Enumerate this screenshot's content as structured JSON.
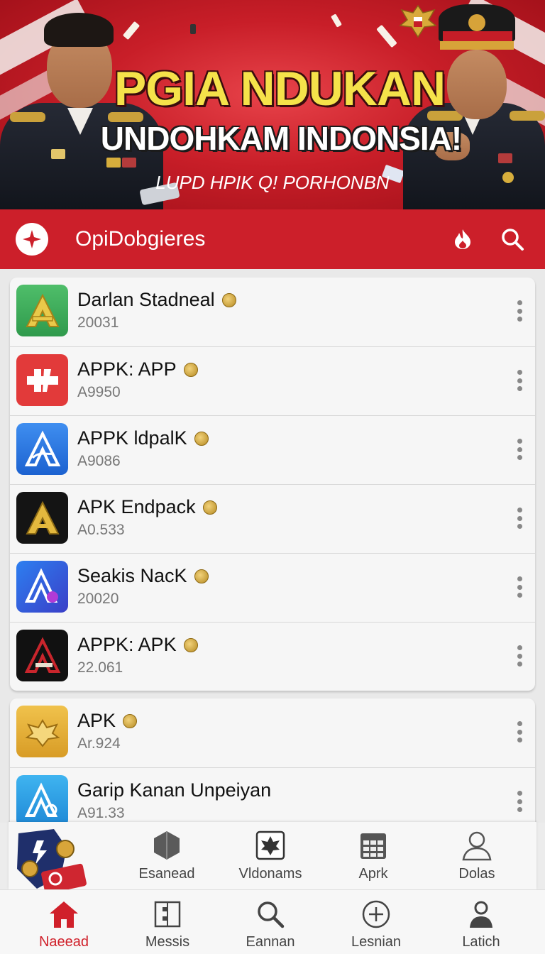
{
  "banner": {
    "title_line1": "PGIA NDUKAN",
    "title_line2": "UNDOHKAM INDONSIA!",
    "subtitle": "LUPD HPIK Q! PORHONBN"
  },
  "toolbar": {
    "title": "OpiDobgieres",
    "accent_color": "#cc1f2a"
  },
  "apps": [
    {
      "name": "Darlan Stadneal",
      "sub": "20031",
      "icon": "letter-a-green-icon"
    },
    {
      "name": "APPK: APP",
      "sub": "A9950",
      "icon": "pulse-red-icon"
    },
    {
      "name": "APPK ldpalK",
      "sub": "A9086",
      "icon": "letter-a-blue-icon"
    },
    {
      "name": "APK Endpack",
      "sub": "A0.533",
      "icon": "letter-a-gold-icon"
    },
    {
      "name": "Seakis NacK",
      "sub": "20020",
      "icon": "letter-a-blue-gradient-icon"
    },
    {
      "name": "APPK: APK",
      "sub": "22.061",
      "icon": "letter-a-red-dark-icon"
    },
    {
      "name": "APK",
      "sub": "Ar.924",
      "icon": "garuda-gold-icon"
    },
    {
      "name": "Garip Kanan Unpeiyan",
      "sub": "A91.33",
      "icon": "letter-a-light-blue-icon"
    }
  ],
  "shortcuts": [
    {
      "label": "Esanead",
      "icon": "cube-icon"
    },
    {
      "label": "Vldonams",
      "icon": "garuda-icon"
    },
    {
      "label": "Aprk",
      "icon": "calendar-grid-icon"
    },
    {
      "label": "Dolas",
      "icon": "user-icon"
    }
  ],
  "nav": [
    {
      "label": "Naeead",
      "icon": "home-icon",
      "active": true
    },
    {
      "label": "Messis",
      "icon": "grid-box-icon"
    },
    {
      "label": "Eannan",
      "icon": "search-icon"
    },
    {
      "label": "Lesnian",
      "icon": "add-circle-icon"
    },
    {
      "label": "Latich",
      "icon": "profile-icon"
    }
  ]
}
